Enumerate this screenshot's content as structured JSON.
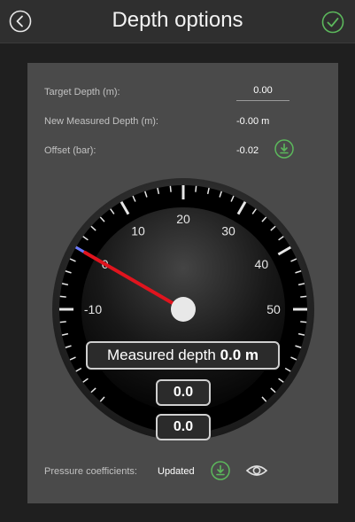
{
  "header": {
    "title": "Depth options",
    "back_icon": "back-arrow-circle-icon",
    "confirm_icon": "check-circle-icon",
    "accent": "#5cb85c"
  },
  "form": {
    "target_depth_label": "Target Depth (m):",
    "target_depth_value": "0.00",
    "new_measured_label": "New Measured Depth (m):",
    "new_measured_value": "-0.00 m",
    "offset_label": "Offset (bar):",
    "offset_value": "-0.02"
  },
  "gauge": {
    "min": -10,
    "max": 50,
    "tick_labels": [
      "-10",
      "0",
      "10",
      "20",
      "30",
      "40",
      "50"
    ],
    "needle_value": 0.0,
    "needle_color": "#e0141e",
    "measured_label": "Measured depth",
    "measured_value": "0.0 m",
    "readout_2": "0.0",
    "readout_3": "0.0"
  },
  "footer": {
    "pressure_label": "Pressure coefficients:",
    "pressure_status": "Updated",
    "download_icon": "download-circle-icon",
    "view_icon": "eye-icon"
  }
}
